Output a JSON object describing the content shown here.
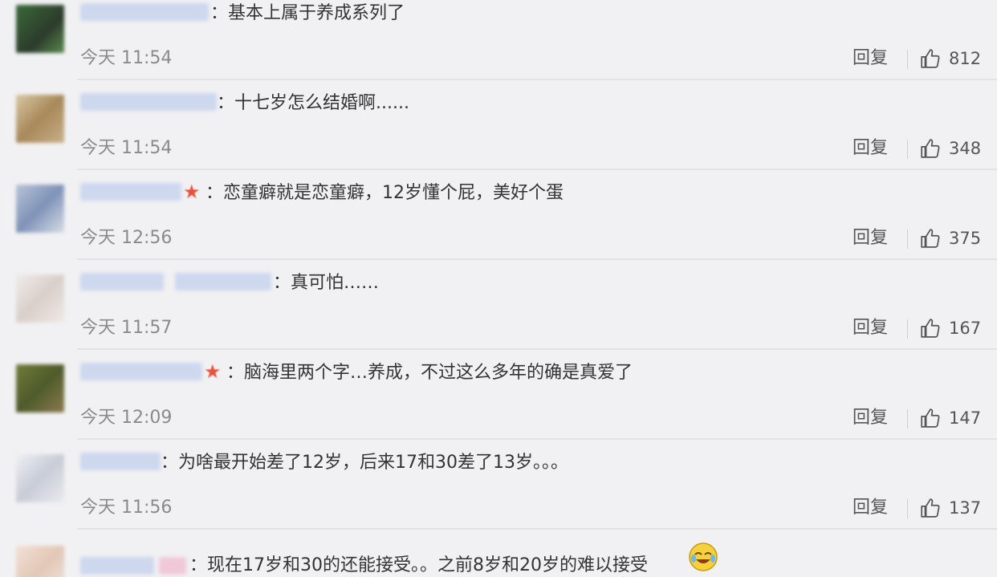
{
  "comments": [
    {
      "text": "：基本上属于养成系列了",
      "time": "今天 11:54",
      "reply": "回复",
      "likes": "812"
    },
    {
      "text": "：十七岁怎么结婚啊......",
      "time": "今天 11:54",
      "reply": "回复",
      "likes": "348"
    },
    {
      "text": "：恋童癖就是恋童癖，12岁懂个屁，美好个蛋",
      "time": "今天 12:56",
      "reply": "回复",
      "likes": "375"
    },
    {
      "text": "：真可怕……",
      "time": "今天 11:57",
      "reply": "回复",
      "likes": "167"
    },
    {
      "text": "：脑海里两个字…养成，不过这么多年的确是真爱了",
      "time": "今天 12:09",
      "reply": "回复",
      "likes": "147"
    },
    {
      "text": "：为啥最开始差了12岁，后来17和30差了13岁。。。",
      "time": "今天 11:56",
      "reply": "回复",
      "likes": "137"
    },
    {
      "text": "：现在17岁和30的还能接受。。之前8岁和20岁的难以接受",
      "time": "",
      "reply": "",
      "likes": ""
    }
  ],
  "icons": {
    "like": "thumbs-up-icon",
    "emoji": "crying-laughing-emoji-icon",
    "vip": "star-badge-icon"
  },
  "colors": {
    "background": "#f1f1f3",
    "star": "#e8533c",
    "username_blur": "#cdd7ee"
  }
}
